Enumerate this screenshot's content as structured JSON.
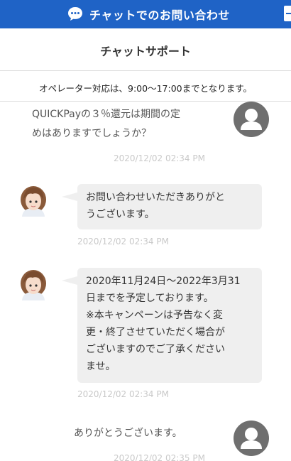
{
  "topbar": {
    "title": "チャットでのお問い合わせ",
    "icon": "speech-bubble-icon"
  },
  "header": {
    "title": "チャットサポート"
  },
  "notice": {
    "text": "オペレーター対応は、9:00〜17:00までとなります。"
  },
  "messages": [
    {
      "sender": "user",
      "lines": [
        "QUICKPayの３％還元は期間の定",
        "めはありますでしょうか？"
      ],
      "timestamp": "2020/12/02 02:34 PM"
    },
    {
      "sender": "operator",
      "lines": [
        "お問い合わせいただきありがと",
        "うございます。"
      ],
      "timestamp": "2020/12/02 02:34 PM"
    },
    {
      "sender": "operator",
      "lines": [
        "2020年11月24日〜2022年3月31",
        "日までを予定しております。",
        "※本キャンペーンは予告なく変",
        "更・終了させていただく場合が",
        "ございますのでご了承ください",
        "ませ。"
      ],
      "timestamp": "2020/12/02 02:34 PM"
    },
    {
      "sender": "user",
      "lines": [
        "ありがとうございます。"
      ],
      "timestamp": "2020/12/02 02:35 PM"
    }
  ],
  "colors": {
    "topbar": "#1f63c6",
    "bubble": "#efefef",
    "timestamp": "#c9c9c9"
  }
}
